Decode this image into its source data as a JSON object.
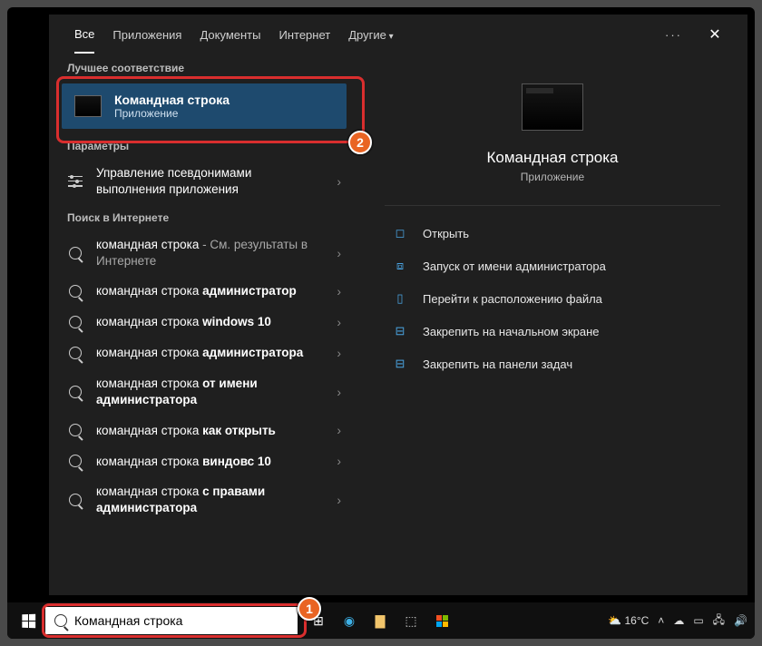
{
  "tabs": {
    "all": "Все",
    "apps": "Приложения",
    "docs": "Документы",
    "internet": "Интернет",
    "more": "Другие"
  },
  "sections": {
    "best": "Лучшее соответствие",
    "params": "Параметры",
    "web": "Поиск в Интернете"
  },
  "bestMatch": {
    "title": "Командная строка",
    "subtitle": "Приложение"
  },
  "paramsItem": "Управление псевдонимами выполнения приложения",
  "webResults": [
    {
      "plain": "командная строка",
      "tail": " - См. результаты в Интернете"
    },
    {
      "plain": "командная строка ",
      "bold": "администратор",
      "tail": ""
    },
    {
      "plain": "командная строка ",
      "bold": "windows 10",
      "tail": ""
    },
    {
      "plain": "командная строка ",
      "bold": "администратора",
      "tail": ""
    },
    {
      "plain": "командная строка ",
      "bold": "от имени администратора",
      "tail": ""
    },
    {
      "plain": "командная строка ",
      "bold": "как открыть",
      "tail": ""
    },
    {
      "plain": "командная строка ",
      "bold": "виндовс 10",
      "tail": ""
    },
    {
      "plain": "командная строка ",
      "bold": "с правами администратора",
      "tail": ""
    }
  ],
  "preview": {
    "title": "Командная строка",
    "subtitle": "Приложение",
    "actions": {
      "open": "Открыть",
      "runAdmin": "Запуск от имени администратора",
      "fileLocation": "Перейти к расположению файла",
      "pinStart": "Закрепить на начальном экране",
      "pinTaskbar": "Закрепить на панели задач"
    }
  },
  "search": {
    "value": "Командная строка"
  },
  "badges": {
    "one": "1",
    "two": "2"
  },
  "tray": {
    "temp": "16°C"
  }
}
